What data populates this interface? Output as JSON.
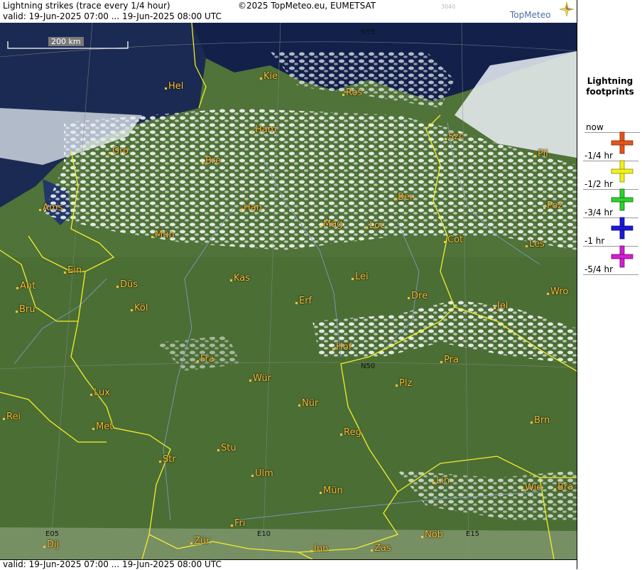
{
  "header": {
    "title": "Lightning strikes (trace every 1/4 hour)",
    "copyright": "©2025 TopMeteo.eu, EUMETSAT",
    "code": "3040",
    "brand": "TopMeteo",
    "valid": "valid:  19-Jun-2025 07:00 ... 19-Jun-2025 08:00 UTC"
  },
  "footer": {
    "valid": "valid:  19-Jun-2025 07:00 ... 19-Jun-2025 08:00 UTC"
  },
  "scale": {
    "label": "200 km"
  },
  "legend": {
    "title_line1": "Lightning",
    "title_line2": "footprints",
    "items": [
      {
        "label": "now",
        "color": "#e5541a"
      },
      {
        "label": "-1/4 hr",
        "color": "#f2f01e"
      },
      {
        "label": "-1/2 hr",
        "color": "#2ed22e"
      },
      {
        "label": "-3/4 hr",
        "color": "#1a1ad8"
      },
      {
        "label": "-1 hr",
        "color": "#d21ed2"
      },
      {
        "label": "-5/4 hr",
        "color": ""
      }
    ]
  },
  "grid_labels": [
    "N55",
    "N50",
    "E05",
    "E10",
    "E15"
  ],
  "cities": [
    "Hel",
    "Kie",
    "Ros",
    "Ham",
    "Szc",
    "Gro",
    "Bre",
    "Pil",
    "Ber",
    "Ams",
    "Han",
    "Poz",
    "Mag",
    "Loc",
    "Cot",
    "Mün",
    "Les",
    "Ein",
    "Kas",
    "Lei",
    "Ant",
    "Düs",
    "Dre",
    "Wro",
    "Bru",
    "Köl",
    "Erf",
    "Jel",
    "Hof",
    "Fra",
    "Pra",
    "Wür",
    "Lux",
    "Plz",
    "Rei",
    "Nür",
    "Met",
    "Brn",
    "Reg",
    "Stu",
    "Str",
    "Ulm",
    "Lin",
    "Wie",
    "Bra",
    "Mün",
    "Fri",
    "Nöb",
    "Dij",
    "Zür",
    "Inn",
    "Zas"
  ]
}
